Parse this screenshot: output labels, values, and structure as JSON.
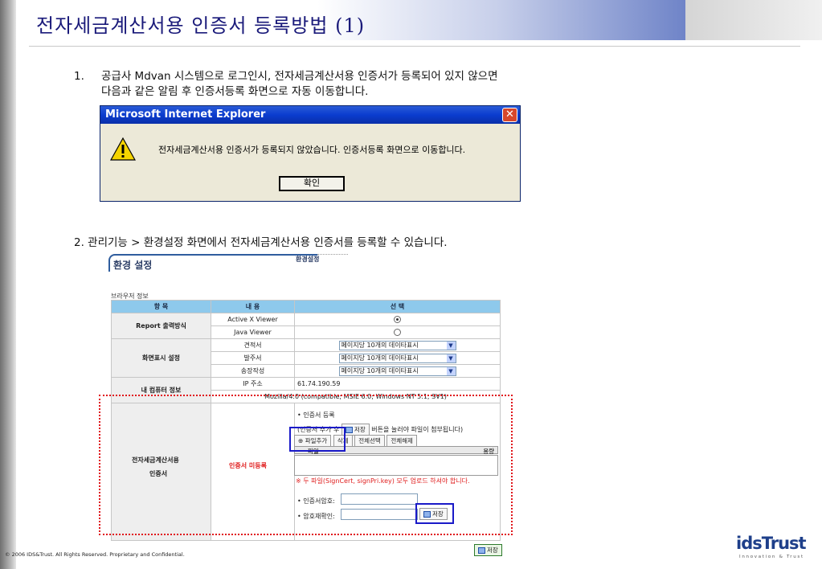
{
  "page": {
    "title": "전자세금계산서용 인증서 등록방법 (1)",
    "footer": "© 2006 IDS&Trust. All Rights Reserved. Proprietary and Confidential.",
    "logo_main": "idsTrust",
    "logo_tagline": "Innovation & Trust"
  },
  "steps": {
    "step1_num": "1.",
    "step1_line1": "공급사 Mdvan 시스템으로 로그인시, 전자세금계산서용 인증서가 등록되어 있지 않으면",
    "step1_line2": "다음과 같은 알림 후 인증서등록 화면으로 자동 이동합니다.",
    "step2": "2. 관리기능 > 환경설정 화면에서 전자세금계산서용 인증서를 등록할 수 있습니다."
  },
  "dialog": {
    "title": "Microsoft Internet Explorer",
    "message": "전자세금계산서용 인증서가 등록되지 않았습니다. 인증서등록 화면으로 이동합니다.",
    "ok_label": "확인",
    "close_glyph": "✕"
  },
  "settings": {
    "header": "환경 설정",
    "crumb": "환경설정",
    "browser_info": "브라우저 정보",
    "columns": [
      "항 목",
      "내 용",
      "선 택"
    ],
    "report_label": "Report 출력방식",
    "report_options": [
      {
        "name": "Active X Viewer",
        "selected": true
      },
      {
        "name": "Java Viewer",
        "selected": false
      }
    ],
    "display_label": "화면표시 설정",
    "display_rows": [
      {
        "name": "견적서",
        "value": "페이지당 10개의 데이타표시"
      },
      {
        "name": "발주서",
        "value": "페이지당 10개의 데이타표시"
      },
      {
        "name": "송장작성",
        "value": "페이지당 10개의 데이타표시"
      }
    ],
    "computer_label": "내 컴퓨터 정보",
    "ip_label": "IP 주소",
    "ip_value": "61.74.190.59",
    "user_agent": "Mozilla/4.0 (compatible; MSIE 6.0; Windows NT 5.1; SV1)",
    "cert_label_line1": "전자세금계산서용",
    "cert_label_line2": "인증서",
    "cert_status": "인증서 미등록",
    "cert_register_title": "• 인증서 등록",
    "cert_hint_pre": "(인증서 추가 후",
    "cert_hint_post": "버튼을 눌러야 파일이 첨부됩니다)",
    "save_label": "저장",
    "add_file": "파일추가",
    "delete": "삭제",
    "select_all": "전체선택",
    "deselect_all": "전체해제",
    "file_col": "파일",
    "size_col": "용량",
    "upload_warning": "※ 두 파일(SignCert, signPri.key) 모두 업로드 하셔야 합니다.",
    "password_label": "• 인증서암호:",
    "password_confirm_label": "• 암호재확인:",
    "bottom_save": "저장"
  }
}
